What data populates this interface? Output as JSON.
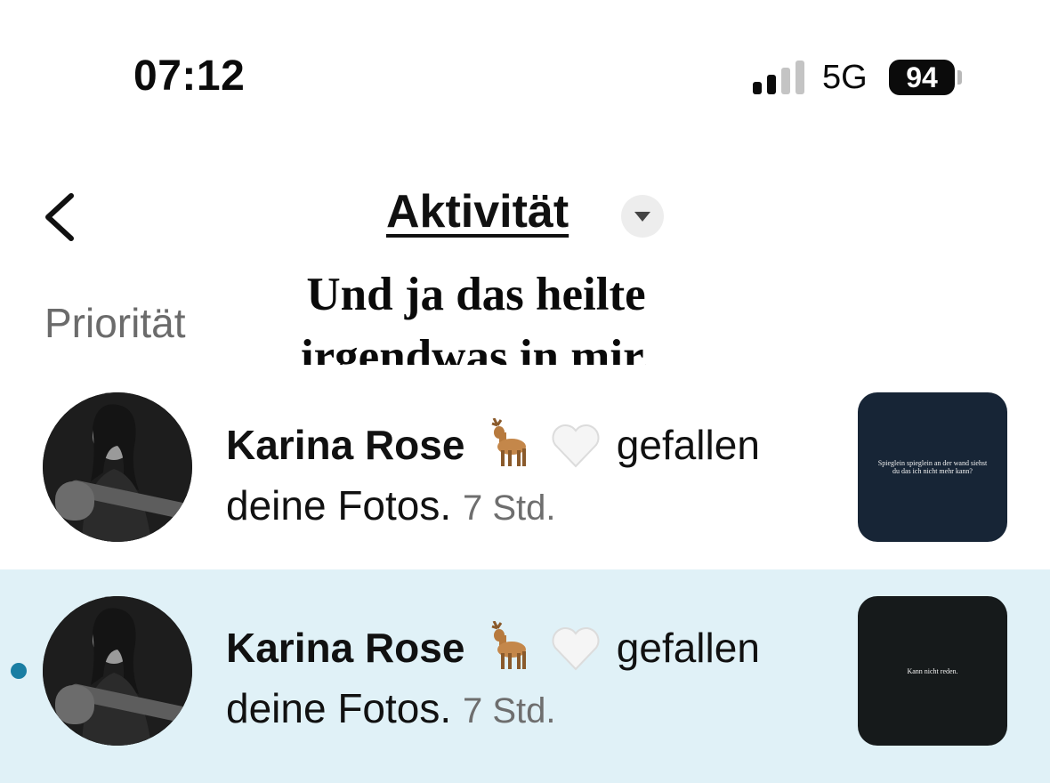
{
  "status_bar": {
    "time": "07:12",
    "network": "5G",
    "battery": "94"
  },
  "header": {
    "title": "Aktivität"
  },
  "overlay_caption": {
    "line1": "Und ja das heilte",
    "line2": "irgendwas in mir."
  },
  "section": {
    "label": "Priorität"
  },
  "notifications": [
    {
      "username": "Karina Rose",
      "emojis": [
        "deer",
        "white-heart"
      ],
      "action": "gefallen deine Fotos.",
      "time": "7 Std.",
      "unread": false,
      "thumbnail_text": "Spieglein spieglein an der wand siehst du das ich nicht mehr kann?"
    },
    {
      "username": "Karina Rose",
      "emojis": [
        "deer",
        "white-heart"
      ],
      "action": "gefallen deine Fotos.",
      "time": "7 Std.",
      "unread": true,
      "thumbnail_text": "Kann nicht reden."
    }
  ],
  "colors": {
    "unread_background": "#e0f1f7",
    "unread_dot": "#1a7ea3",
    "text_primary": "#111111",
    "text_secondary": "#6e6e6e"
  }
}
